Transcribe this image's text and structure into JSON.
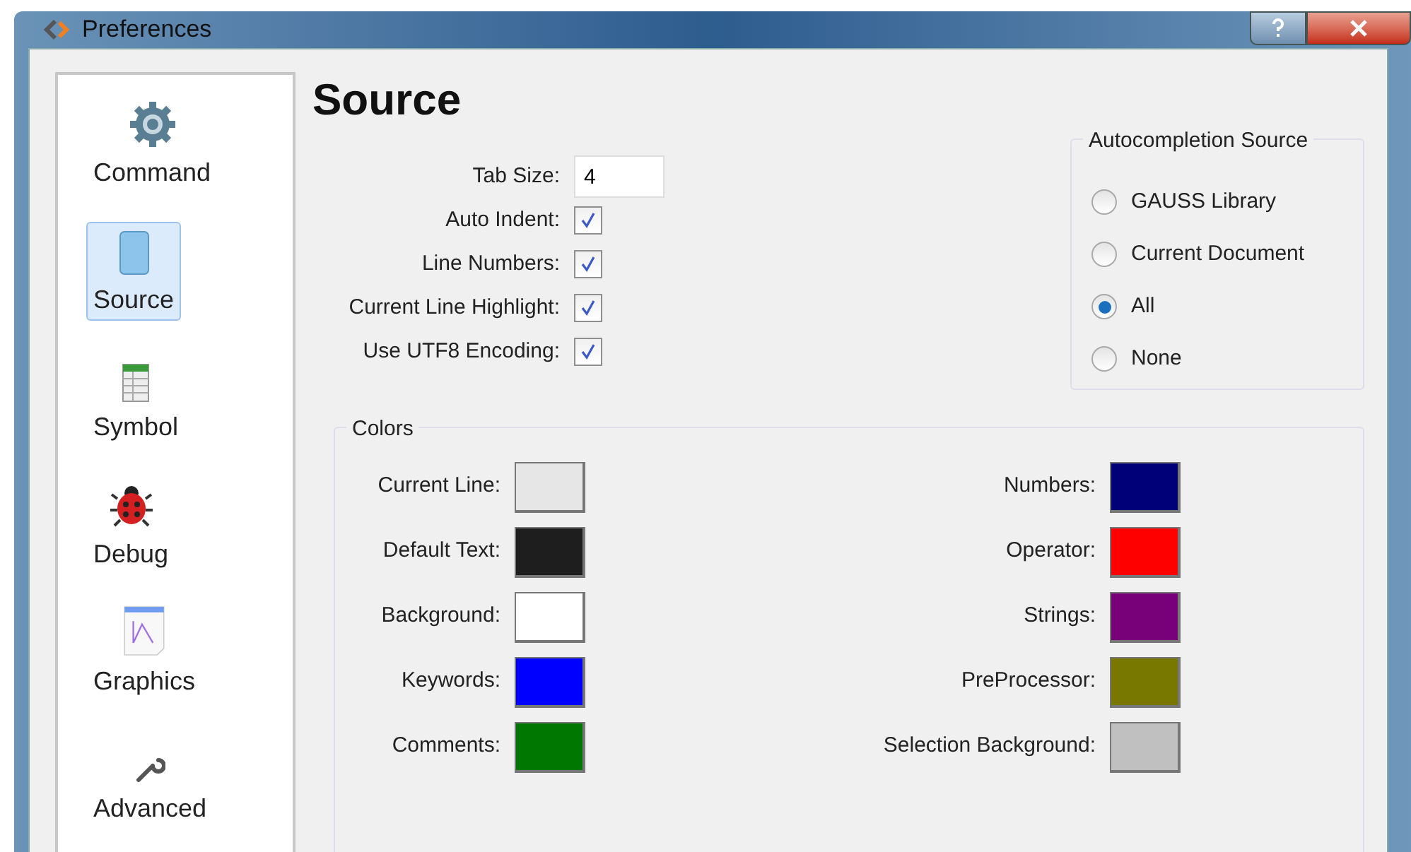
{
  "window": {
    "title": "Preferences"
  },
  "sidebar": {
    "items": [
      {
        "label": "Command",
        "selected": false
      },
      {
        "label": "Source",
        "selected": true
      },
      {
        "label": "Symbol",
        "selected": false
      },
      {
        "label": "Debug",
        "selected": false
      },
      {
        "label": "Graphics",
        "selected": false
      },
      {
        "label": "Advanced",
        "selected": false
      }
    ]
  },
  "page_title": "Source",
  "tab_size": {
    "label": "Tab Size:",
    "value": "4"
  },
  "options": [
    {
      "label": "Auto Indent:",
      "checked": true
    },
    {
      "label": "Line Numbers:",
      "checked": true
    },
    {
      "label": "Current Line Highlight:",
      "checked": true
    },
    {
      "label": "Use UTF8 Encoding:",
      "checked": true
    }
  ],
  "autocompletion": {
    "title": "Autocompletion Source",
    "options": [
      {
        "label": "GAUSS Library",
        "selected": false
      },
      {
        "label": "Current Document",
        "selected": false
      },
      {
        "label": "All",
        "selected": true
      },
      {
        "label": "None",
        "selected": false
      }
    ]
  },
  "colors": {
    "title": "Colors",
    "left": [
      {
        "label": "Current Line:",
        "color": "#e6e6e6"
      },
      {
        "label": "Default Text:",
        "color": "#1e1e1e"
      },
      {
        "label": "Background:",
        "color": "#ffffff"
      },
      {
        "label": "Keywords:",
        "color": "#0000ff"
      },
      {
        "label": "Comments:",
        "color": "#007800"
      }
    ],
    "right": [
      {
        "label": "Numbers:",
        "color": "#000078"
      },
      {
        "label": "Operator:",
        "color": "#ff0000"
      },
      {
        "label": "Strings:",
        "color": "#780078"
      },
      {
        "label": "PreProcessor:",
        "color": "#787800"
      },
      {
        "label": "Selection Background:",
        "color": "#c0c0c0"
      }
    ]
  }
}
